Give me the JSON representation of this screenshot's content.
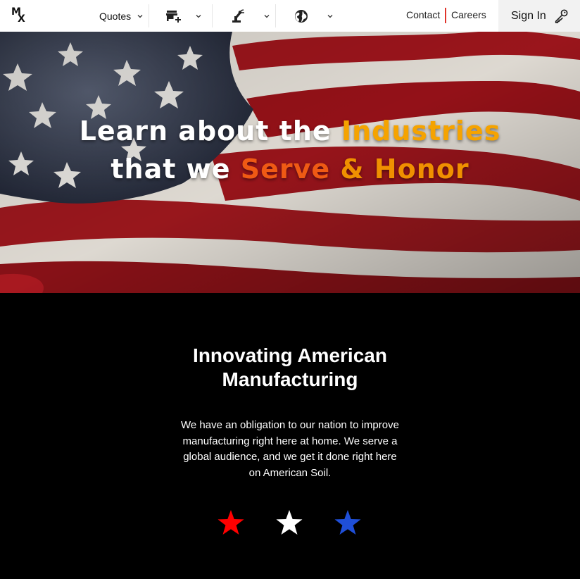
{
  "nav": {
    "logo_text": "MX",
    "items": [
      {
        "label": "Quotes",
        "icon": "chevron-down"
      },
      {
        "icon": "store-add-icon"
      },
      {
        "icon": "robot-arm-icon"
      },
      {
        "icon": "globe-icon"
      }
    ],
    "contact": "Contact",
    "careers": "Careers",
    "sign_in": "Sign In",
    "sign_in_icon": "key-icon",
    "accent_color": "#e0342b"
  },
  "hero": {
    "line1_a": "Learn about the ",
    "line1_b": "Industries",
    "line2_a": "that we ",
    "line2_b": "Serve",
    "line2_c": " & Honor",
    "accent_colors": [
      "#f5a300",
      "#ef5a14",
      "#f09000"
    ]
  },
  "main": {
    "heading_line1": "Innovating American",
    "heading_line2": "Manufacturing",
    "paragraph": "We have an obligation to our nation to improve manufacturing right here at home. We serve a global audience, and we get it done right here on American Soil.",
    "stars": [
      {
        "icon": "star-icon",
        "color": "#ff0000"
      },
      {
        "icon": "star-icon",
        "color": "#ffffff"
      },
      {
        "icon": "star-icon",
        "color": "#1f4fd8"
      }
    ]
  }
}
